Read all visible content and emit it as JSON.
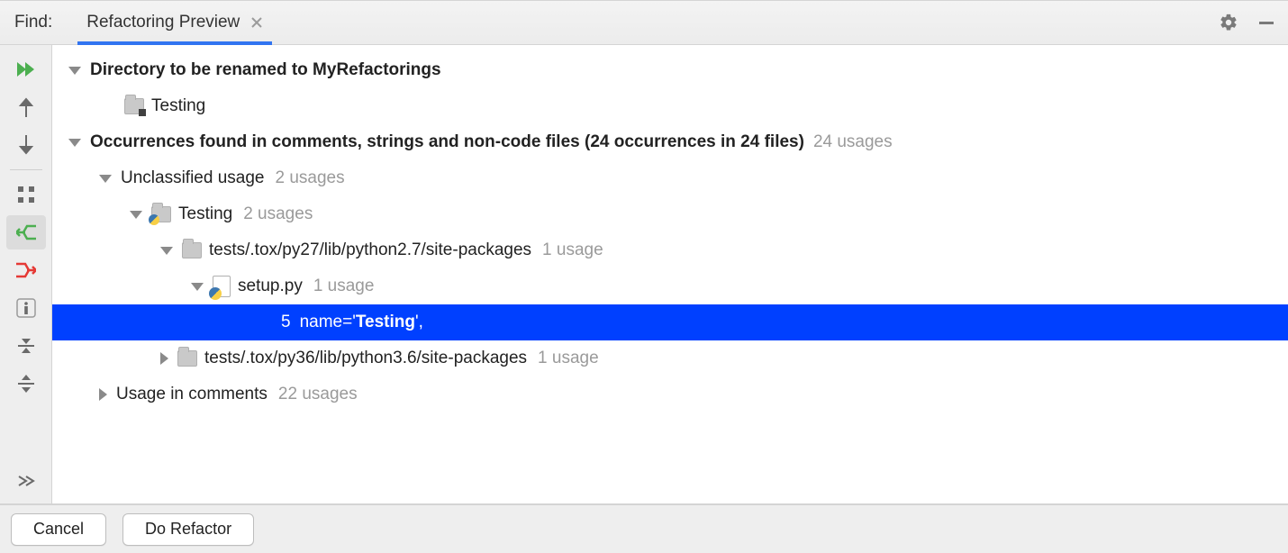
{
  "header": {
    "find_label": "Find:",
    "tab_label": "Refactoring Preview"
  },
  "tree": {
    "rename_header": "Directory to be renamed to MyRefactorings",
    "rename_target": "Testing",
    "occurrences_header_main": "Occurrences found in comments, strings and non-code files  (24 occurrences in 24 files)",
    "occurrences_header_usages": "24 usages",
    "unclassified_label": "Unclassified usage",
    "unclassified_count": "2 usages",
    "testing_module_label": "Testing",
    "testing_module_count": "2 usages",
    "py27_path": "tests/.tox/py27/lib/python2.7/site-packages",
    "py27_count": "1 usage",
    "setup_py_label": "setup.py",
    "setup_py_count": "1 usage",
    "code_line_num": "5",
    "code_line_prefix": "name='",
    "code_line_match": "Testing",
    "code_line_suffix": "',",
    "py36_path": "tests/.tox/py36/lib/python3.6/site-packages",
    "py36_count": "1 usage",
    "usage_in_comments_label": "Usage in comments",
    "usage_in_comments_count": "22 usages"
  },
  "footer": {
    "cancel": "Cancel",
    "do_refactor": "Do Refactor"
  }
}
